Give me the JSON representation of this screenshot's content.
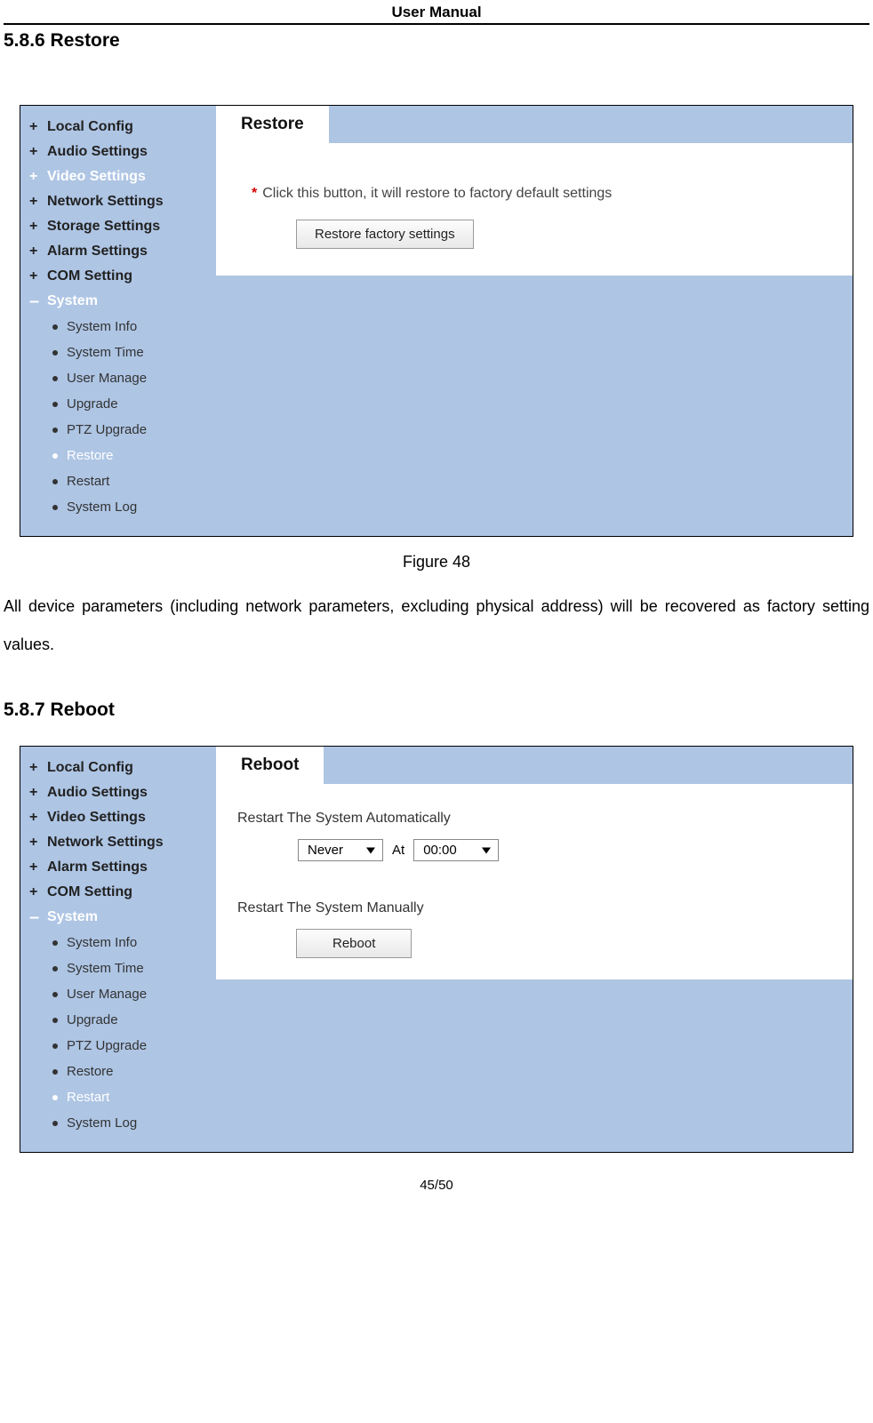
{
  "doc_header": "User Manual",
  "section1": {
    "heading": "5.8.6 Restore",
    "sidebar": {
      "top": [
        {
          "label": "Local Config",
          "white": false
        },
        {
          "label": "Audio Settings",
          "white": false
        },
        {
          "label": "Video Settings",
          "white": true
        },
        {
          "label": "Network Settings",
          "white": false
        },
        {
          "label": "Storage Settings",
          "white": false
        },
        {
          "label": "Alarm Settings",
          "white": false
        },
        {
          "label": "COM Setting",
          "white": false
        }
      ],
      "expanded_label": "System",
      "sub": [
        {
          "label": "System Info",
          "white": false
        },
        {
          "label": "System Time",
          "white": false
        },
        {
          "label": "User Manage",
          "white": false
        },
        {
          "label": "Upgrade",
          "white": false
        },
        {
          "label": "PTZ Upgrade",
          "white": false
        },
        {
          "label": "Restore",
          "white": true
        },
        {
          "label": "Restart",
          "white": false
        },
        {
          "label": "System Log",
          "white": false
        }
      ]
    },
    "panel": {
      "tab": "Restore",
      "hint": "Click this button, it will restore to factory default settings",
      "button": "Restore factory settings"
    },
    "caption": "Figure 48",
    "body": "All device parameters (including network parameters, excluding physical address) will be recovered as factory setting values."
  },
  "section2": {
    "heading": "5.8.7 Reboot",
    "sidebar": {
      "top": [
        {
          "label": "Local Config",
          "white": false
        },
        {
          "label": "Audio Settings",
          "white": false
        },
        {
          "label": "Video Settings",
          "white": false
        },
        {
          "label": "Network Settings",
          "white": false
        },
        {
          "label": "Alarm Settings",
          "white": false
        },
        {
          "label": "COM Setting",
          "white": false
        }
      ],
      "expanded_label": "System",
      "sub": [
        {
          "label": "System Info",
          "white": false
        },
        {
          "label": "System Time",
          "white": false
        },
        {
          "label": "User Manage",
          "white": false
        },
        {
          "label": "Upgrade",
          "white": false
        },
        {
          "label": "PTZ Upgrade",
          "white": false
        },
        {
          "label": "Restore",
          "white": false
        },
        {
          "label": "Restart",
          "white": true
        },
        {
          "label": "System Log",
          "white": false
        }
      ]
    },
    "panel": {
      "tab": "Reboot",
      "auto_label": "Restart The System Automatically",
      "dd_freq": "Never",
      "at_label": "At",
      "dd_time": "00:00",
      "manual_label": "Restart The System Manually",
      "button": "Reboot"
    }
  },
  "page_number": "45/50"
}
